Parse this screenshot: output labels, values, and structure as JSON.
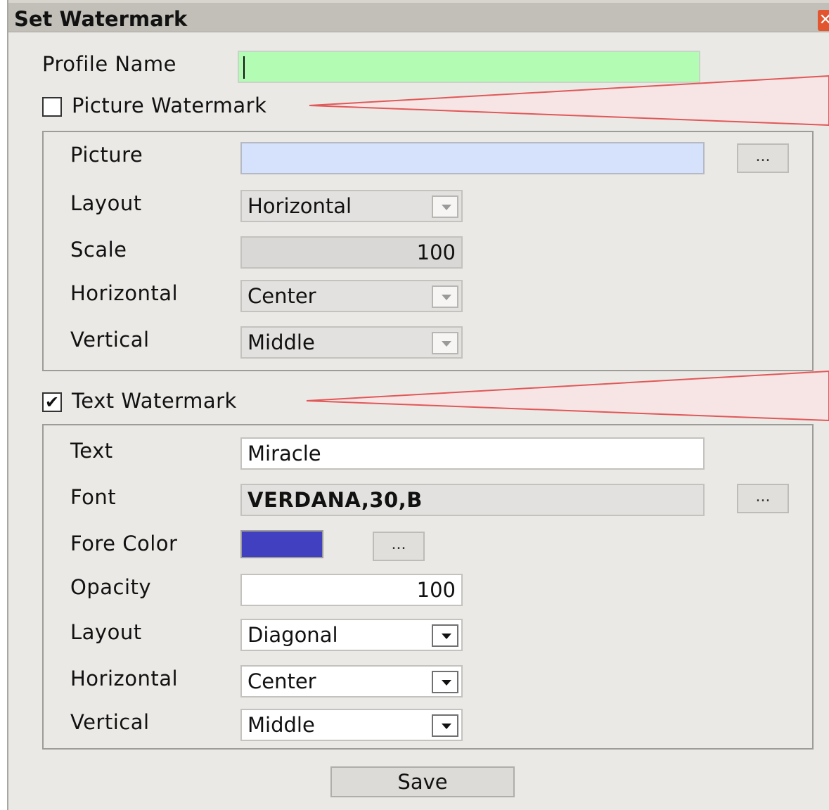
{
  "window": {
    "title": "Set Watermark",
    "close_glyph": "✕"
  },
  "profile": {
    "label": "Profile Name",
    "value": ""
  },
  "picture_watermark": {
    "label": "Picture Watermark",
    "checked": false,
    "picture_label": "Picture",
    "picture_value": "",
    "browse_label": "...",
    "layout_label": "Layout",
    "layout_value": "Horizontal",
    "scale_label": "Scale",
    "scale_value": "100",
    "horizontal_label": "Horizontal",
    "horizontal_value": "Center",
    "vertical_label": "Vertical",
    "vertical_value": "Middle"
  },
  "text_watermark": {
    "label": "Text Watermark",
    "checked": true,
    "check_glyph": "✔",
    "text_label": "Text",
    "text_value": "Miracle",
    "font_label": "Font",
    "font_value": "VERDANA,30,B",
    "font_browse_label": "...",
    "fore_color_label": "Fore Color",
    "fore_color": "#4040c0",
    "color_browse_label": "...",
    "opacity_label": "Opacity",
    "opacity_value": "100",
    "layout_label": "Layout",
    "layout_value": "Diagonal",
    "horizontal_label": "Horizontal",
    "horizontal_value": "Center",
    "vertical_label": "Vertical",
    "vertical_value": "Middle"
  },
  "actions": {
    "save_label": "Save"
  },
  "colors": {
    "profile_field_bg": "#b3fcb3",
    "picture_field_bg": "#d6e2fc",
    "callout_stroke": "#e05858",
    "callout_fill": "#f7e4e4"
  }
}
